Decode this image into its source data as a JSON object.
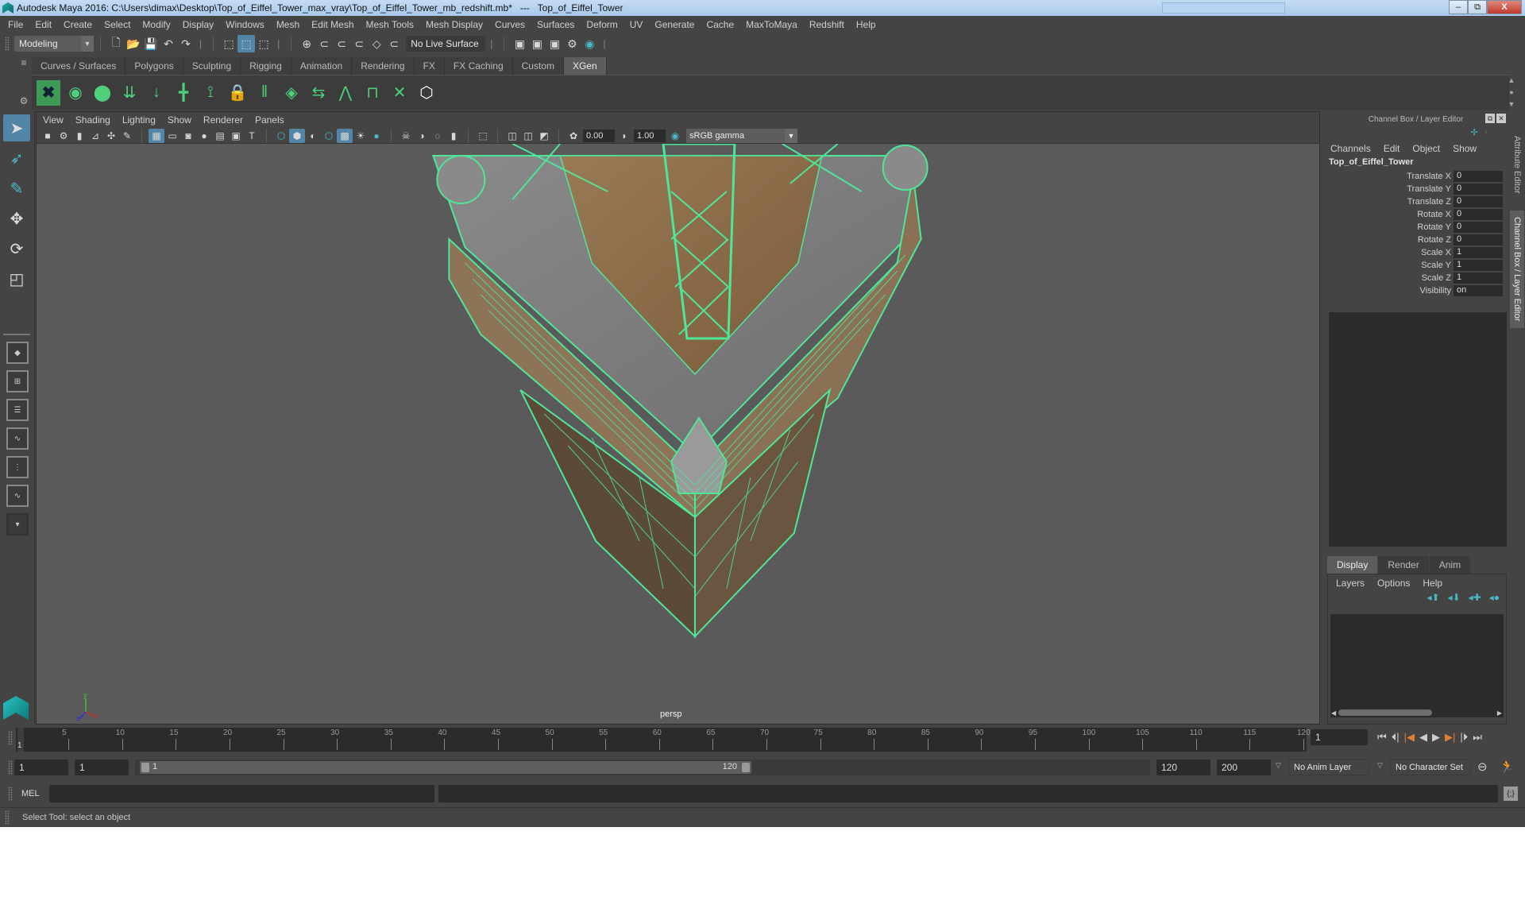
{
  "window": {
    "title": "Autodesk Maya 2016: C:\\Users\\dimax\\Desktop\\Top_of_Eiffel_Tower_max_vray\\Top_of_Eiffel_Tower_mb_redshift.mb*   ---   Top_of_Eiffel_Tower",
    "minimize": "–",
    "restore": "⧉",
    "close": "X"
  },
  "menubar": [
    "File",
    "Edit",
    "Create",
    "Select",
    "Modify",
    "Display",
    "Windows",
    "Mesh",
    "Edit Mesh",
    "Mesh Tools",
    "Mesh Display",
    "Curves",
    "Surfaces",
    "Deform",
    "UV",
    "Generate",
    "Cache",
    "MaxToMaya",
    "Redshift",
    "Help"
  ],
  "statusline": {
    "mode": "Modeling",
    "live_surface": "No Live Surface"
  },
  "shelf": {
    "tabs": [
      "Curves / Surfaces",
      "Polygons",
      "Sculpting",
      "Rigging",
      "Animation",
      "Rendering",
      "FX",
      "FX Caching",
      "Custom",
      "XGen"
    ],
    "active_tab": "XGen",
    "icons": [
      "xgen-editor-icon",
      "xgen-preview-icon",
      "xgen-clear-icon",
      "xgen-create-guides-icon",
      "xgen-place-icon",
      "xgen-add-guide-icon",
      "xgen-rebuild-guide-icon",
      "xgen-lock-guide-icon",
      "xgen-select-guides-icon",
      "xgen-guides-to-curves-icon",
      "xgen-flip-icon",
      "xgen-sculpt-icon",
      "xgen-normalize-icon",
      "xgen-delete-guide-icon",
      "xgen-igs-icon"
    ]
  },
  "viewport": {
    "menu": [
      "View",
      "Shading",
      "Lighting",
      "Show",
      "Renderer",
      "Panels"
    ],
    "exposure": "0.00",
    "gamma": "1.00",
    "color_space": "sRGB gamma",
    "camera_label": "persp",
    "axis": {
      "x": "x",
      "y": "y",
      "z": "z"
    }
  },
  "channel_box": {
    "header": "Channel Box / Layer Editor",
    "menu": [
      "Channels",
      "Edit",
      "Object",
      "Show"
    ],
    "object_name": "Top_of_Eiffel_Tower",
    "channels": [
      {
        "label": "Translate X",
        "value": "0"
      },
      {
        "label": "Translate Y",
        "value": "0"
      },
      {
        "label": "Translate Z",
        "value": "0"
      },
      {
        "label": "Rotate X",
        "value": "0"
      },
      {
        "label": "Rotate Y",
        "value": "0"
      },
      {
        "label": "Rotate Z",
        "value": "0"
      },
      {
        "label": "Scale X",
        "value": "1"
      },
      {
        "label": "Scale Y",
        "value": "1"
      },
      {
        "label": "Scale Z",
        "value": "1"
      },
      {
        "label": "Visibility",
        "value": "on"
      }
    ]
  },
  "layer_editor": {
    "tabs": [
      "Display",
      "Render",
      "Anim"
    ],
    "active_tab": "Display",
    "menu": [
      "Layers",
      "Options",
      "Help"
    ]
  },
  "side_tabs": [
    "Attribute Editor",
    "Channel Box / Layer Editor"
  ],
  "timeline": {
    "ticks": [
      "5",
      "10",
      "15",
      "20",
      "25",
      "30",
      "35",
      "40",
      "45",
      "50",
      "55",
      "60",
      "65",
      "70",
      "75",
      "80",
      "85",
      "90",
      "95",
      "100",
      "105",
      "110",
      "115",
      "120"
    ],
    "current_frame": "1",
    "current_frame_field": "1"
  },
  "range": {
    "start": "1",
    "playback_start": "1",
    "slider_start": "1",
    "slider_end": "120",
    "playback_end": "120",
    "end": "200",
    "anim_layer": "No Anim Layer",
    "character_set": "No Character Set"
  },
  "command_line": {
    "label": "MEL",
    "value": ""
  },
  "help_line": "Select Tool: select an object",
  "colors": {
    "accent": "#5285a6",
    "wireframe": "#4fe69a",
    "playback_accent": "#e07b39"
  }
}
